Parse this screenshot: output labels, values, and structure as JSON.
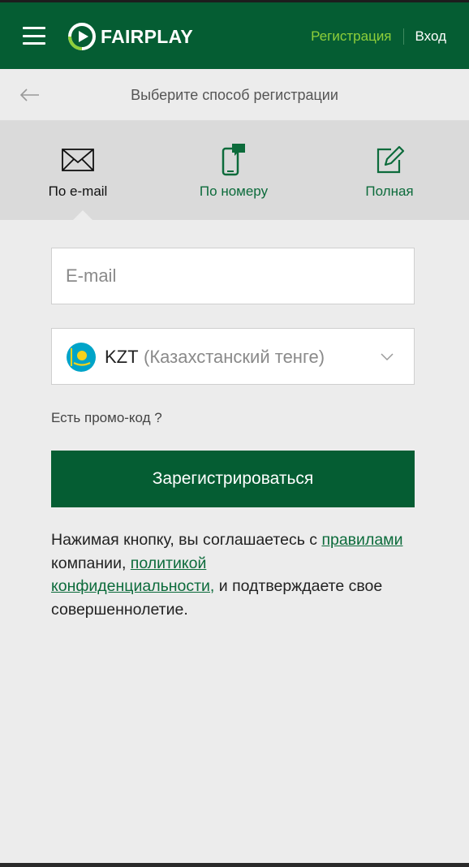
{
  "header": {
    "brand": "FAIRPLAY",
    "register_label": "Регистрация",
    "login_label": "Вход",
    "colors": {
      "bar": "#055d33",
      "accent": "#8fcf3a"
    }
  },
  "subheader": {
    "title": "Выберите способ регистрации"
  },
  "tabs": [
    {
      "label": "По e-mail",
      "icon": "envelope-icon",
      "active": true
    },
    {
      "label": "По номеру",
      "icon": "phone-chat-icon",
      "active": false
    },
    {
      "label": "Полная",
      "icon": "edit-icon",
      "active": false
    }
  ],
  "form": {
    "email_placeholder": "E-mail",
    "email_value": "",
    "currency": {
      "code": "KZT",
      "name": "(Казахстанский тенге)",
      "icon": "kz-flag-icon"
    },
    "promo_label": "Есть промо-код ?",
    "submit_label": "Зарегистрироваться"
  },
  "terms": {
    "p1": "Нажимая кнопку, вы соглашаетесь с ",
    "rules_link": "правилами",
    "p2": " компании, ",
    "policy_link1": "политикой",
    "policy_link2": "конфиденциальности,",
    "p3": " и подтверждаете свое совершеннолетие."
  }
}
